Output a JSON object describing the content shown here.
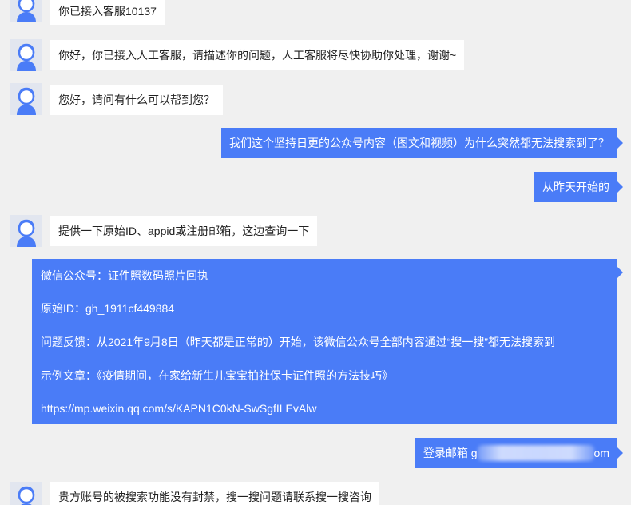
{
  "colors": {
    "background": "#f0f0f0",
    "incoming_bubble": "#ffffff",
    "outgoing_bubble": "#4a7cf7",
    "incoming_text": "#222222",
    "outgoing_text": "#ffffff"
  },
  "messages": {
    "m1": {
      "sender": "agent",
      "text": "你已接入客服10137"
    },
    "m2": {
      "sender": "agent",
      "text": "你好，你已接入人工客服，请描述你的问题，人工客服将尽快协助你处理，谢谢~"
    },
    "m3": {
      "sender": "agent",
      "text": "您好，请问有什么可以帮到您？"
    },
    "m4": {
      "sender": "user",
      "text": "我们这个坚持日更的公众号内容（图文和视频）为什么突然都无法搜索到了？"
    },
    "m5": {
      "sender": "user",
      "text": "从昨天开始的"
    },
    "m6": {
      "sender": "agent",
      "text": "提供一下原始ID、appid或注册邮箱，这边查询一下"
    },
    "m7": {
      "sender": "user",
      "lines": [
        "微信公众号：证件照数码照片回执",
        "原始ID：gh_1911cf449884",
        "问题反馈：从2021年9月8日（昨天都是正常的）开始，该微信公众号全部内容通过“搜一搜”都无法搜索到",
        "示例文章：《疫情期间，在家给新生儿宝宝拍社保卡证件照的方法技巧》",
        "https://mp.weixin.qq.com/s/KAPN1C0kN-SwSgfILEvAlw"
      ]
    },
    "m8": {
      "sender": "user",
      "prefix": "登录邮箱 g",
      "suffix": "om"
    },
    "m9": {
      "sender": "agent",
      "text": "贵方账号的被搜索功能没有封禁，搜一搜问题请联系搜一搜咨询"
    }
  },
  "icons": {
    "agent_avatar": "customer-service-avatar-icon"
  }
}
